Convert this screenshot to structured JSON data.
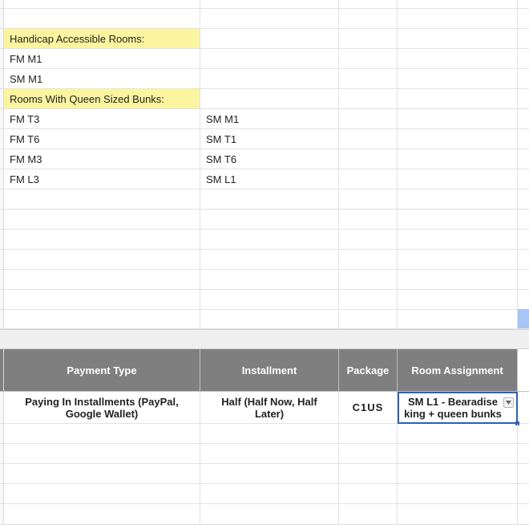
{
  "top_section": {
    "handicap_header": "Handicap Accessible Rooms:",
    "handicap_rooms": [
      "FM M1",
      "SM M1"
    ],
    "queen_header": "Rooms With Queen Sized Bunks:",
    "queen_rooms": [
      [
        "FM T3",
        "SM M1"
      ],
      [
        "FM T6",
        "SM T1"
      ],
      [
        "FM M3",
        "SM T6"
      ],
      [
        "FM L3",
        "SM L1"
      ]
    ]
  },
  "table": {
    "headers": [
      "Payment Type",
      "Installment",
      "Package",
      "Room Assignment"
    ],
    "row": {
      "payment_type": "Paying In Installments (PayPal, Google Wallet)",
      "installment": "Half (Half Now, Half Later)",
      "package": "C1US",
      "room_assignment": "SM L1 - Bearadise king + queen bunks"
    }
  },
  "colors": {
    "highlight_yellow": "#fbf59f",
    "header_gray": "#7f7f7f",
    "selection_blue": "#2f5fb3"
  }
}
